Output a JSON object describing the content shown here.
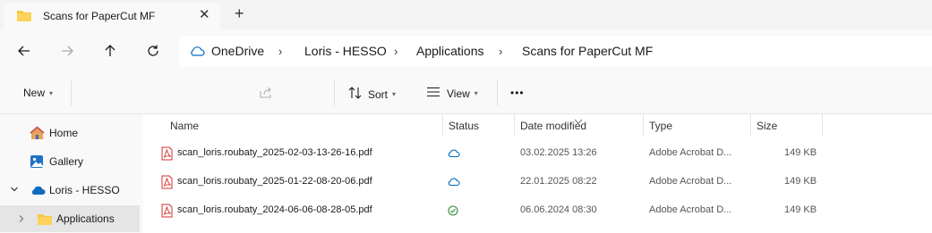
{
  "tab": {
    "title": "Scans for PaperCut MF",
    "close": "✕",
    "new_tab": "+"
  },
  "nav": {
    "back": "←",
    "forward": "→",
    "up": "↑",
    "refresh": "↻"
  },
  "breadcrumb": {
    "items": [
      "OneDrive",
      "Loris - HESSO",
      "Applications",
      "Scans for PaperCut MF"
    ],
    "separator": "›"
  },
  "toolbar": {
    "new_label": "New",
    "sort_label": "Sort",
    "view_label": "View",
    "more_label": "•••"
  },
  "sidebar": {
    "items": [
      {
        "label": "Home",
        "icon": "home-icon"
      },
      {
        "label": "Gallery",
        "icon": "gallery-icon"
      },
      {
        "label": "Loris - HESSO",
        "icon": "onedrive-icon"
      },
      {
        "label": "Applications",
        "icon": "folder-icon"
      }
    ]
  },
  "columns": {
    "name": "Name",
    "status": "Status",
    "date": "Date modified",
    "type": "Type",
    "size": "Size"
  },
  "files": [
    {
      "name": "scan_loris.roubaty_2025-02-03-13-26-16.pdf",
      "status": "cloud",
      "date": "03.02.2025 13:26",
      "type": "Adobe Acrobat D...",
      "size": "149 KB"
    },
    {
      "name": "scan_loris.roubaty_2025-01-22-08-20-06.pdf",
      "status": "cloud",
      "date": "22.01.2025 08:22",
      "type": "Adobe Acrobat D...",
      "size": "149 KB"
    },
    {
      "name": "scan_loris.roubaty_2024-06-06-08-28-05.pdf",
      "status": "available",
      "date": "06.06.2024 08:30",
      "type": "Adobe Acrobat D...",
      "size": "149 KB"
    }
  ],
  "colors": {
    "accent": "#0067c0",
    "folder": "#f8c640",
    "pdf": "#d32f2f",
    "synced": "#2e8b3d",
    "selected": "#e5e5e5"
  }
}
